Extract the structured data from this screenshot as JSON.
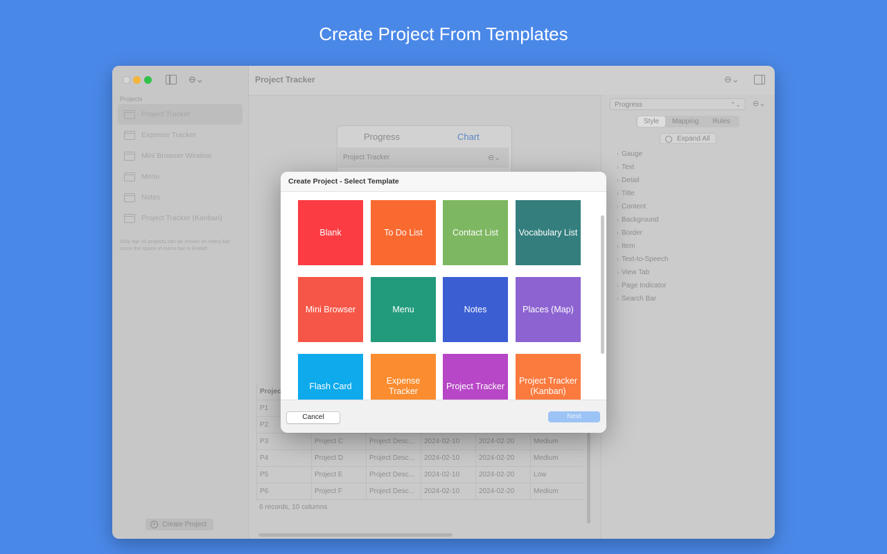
{
  "headline": "Create Project From Templates",
  "colors": {
    "background": "#4a88e8",
    "next_button": "#9cc3f5"
  },
  "sidebar": {
    "section_label": "Projects",
    "items": [
      {
        "label": "Project Tracker",
        "selected": true,
        "icon": "folder-icon"
      },
      {
        "label": "Expense Tracker",
        "icon": "folder-icon"
      },
      {
        "label": "Mini Browser Window",
        "icon": "folder-icon"
      },
      {
        "label": "Menu",
        "icon": "folder-icon"
      },
      {
        "label": "Notes",
        "icon": "folder-icon"
      },
      {
        "label": "Project Tracker (Kanban)",
        "icon": "folder-icon"
      }
    ],
    "note": "Only top 10 projects can be shown on menu bar since the space of menu bar is limited.",
    "create_button": "Create Project"
  },
  "toolbar": {
    "title": "Project Tracker",
    "more_icon": "ellipsis-circle-icon",
    "inspector_icon": "sidebar-right-icon"
  },
  "preview": {
    "tab_left": "Progress",
    "tab_right": "Chart",
    "row_name": "Project Tracker"
  },
  "table": {
    "header": [
      "Project",
      "",
      "",
      "",
      "",
      ""
    ],
    "rows": [
      [
        "P1",
        "",
        "",
        "",
        "",
        ""
      ],
      [
        "P2",
        "",
        "",
        "",
        "",
        ""
      ],
      [
        "P3",
        "Project C",
        "Project Desc...",
        "2024-02-10",
        "2024-02-20",
        "Medium"
      ],
      [
        "P4",
        "Project D",
        "Project Desc...",
        "2024-02-10",
        "2024-02-20",
        "Medium"
      ],
      [
        "P5",
        "Project E",
        "Project Desc...",
        "2024-02-10",
        "2024-02-20",
        "Low"
      ],
      [
        "P6",
        "Project F",
        "Project Desc...",
        "2024-02-10",
        "2024-02-20",
        "Medium"
      ]
    ],
    "summary": "6 records, 10 columns"
  },
  "inspector": {
    "selected": "Progress",
    "tabs": [
      "Style",
      "Mapping",
      "Rules"
    ],
    "active_tab": "Style",
    "expand_all": "Expand All",
    "properties": [
      "Gauge",
      "Text",
      "Detail",
      "Title",
      "Content",
      "Background",
      "Border",
      "Item",
      "Text-to-Speech",
      "View Tab",
      "Page Indicator",
      "Search Bar"
    ]
  },
  "dialog": {
    "title": "Create Project - Select Template",
    "templates": [
      {
        "label": "Blank",
        "color": "#fb3c43"
      },
      {
        "label": "To Do List",
        "color": "#f96a31"
      },
      {
        "label": "Contact List",
        "color": "#7db761"
      },
      {
        "label": "Vocabulary List",
        "color": "#347f7d"
      },
      {
        "label": "Mini Browser",
        "color": "#f65647"
      },
      {
        "label": "Menu",
        "color": "#229b7c"
      },
      {
        "label": "Notes",
        "color": "#3b5ed3"
      },
      {
        "label": "Places (Map)",
        "color": "#8c63d1"
      },
      {
        "label": "Flash Card",
        "color": "#0eaaec"
      },
      {
        "label": "Expense Tracker",
        "color": "#fb8c2f"
      },
      {
        "label": "Project Tracker",
        "color": "#b747c6"
      },
      {
        "label": "Project Tracker (Kanban)",
        "color": "#fb7a3e"
      }
    ],
    "cancel": "Cancel",
    "next": "Next"
  }
}
